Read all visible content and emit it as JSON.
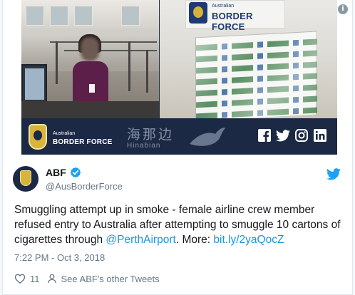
{
  "banner": {
    "top_text_small": "Australian",
    "top_text_big": "BORDER FORCE",
    "bar_text_small": "Australian",
    "bar_text_big": "BORDER FORCE",
    "watermark_cn": "海那边",
    "watermark_en": "Hinabian",
    "social_icons": [
      "facebook-icon",
      "twitter-icon",
      "instagram-icon",
      "linkedin-icon"
    ],
    "colors": {
      "navy": "#1b2945",
      "gold": "#d8b43c"
    }
  },
  "tweet": {
    "display_name": "ABF",
    "handle": "@AusBorderForce",
    "text_part1": "Smuggling attempt up in smoke - female airline crew member refused entry to Australia after attempting to smuggle 10 cartons of cigarettes through ",
    "mention": "@PerthAirport",
    "text_part2": ". More: ",
    "link": "bit.ly/2yaQocZ",
    "timestamp": "7:22 PM - Oct 3, 2018",
    "like_count": "11",
    "see_more": "See ABF's other Tweets",
    "colors": {
      "link": "#1b95e0",
      "verified": "#1da1f2",
      "muted": "#657786"
    }
  }
}
